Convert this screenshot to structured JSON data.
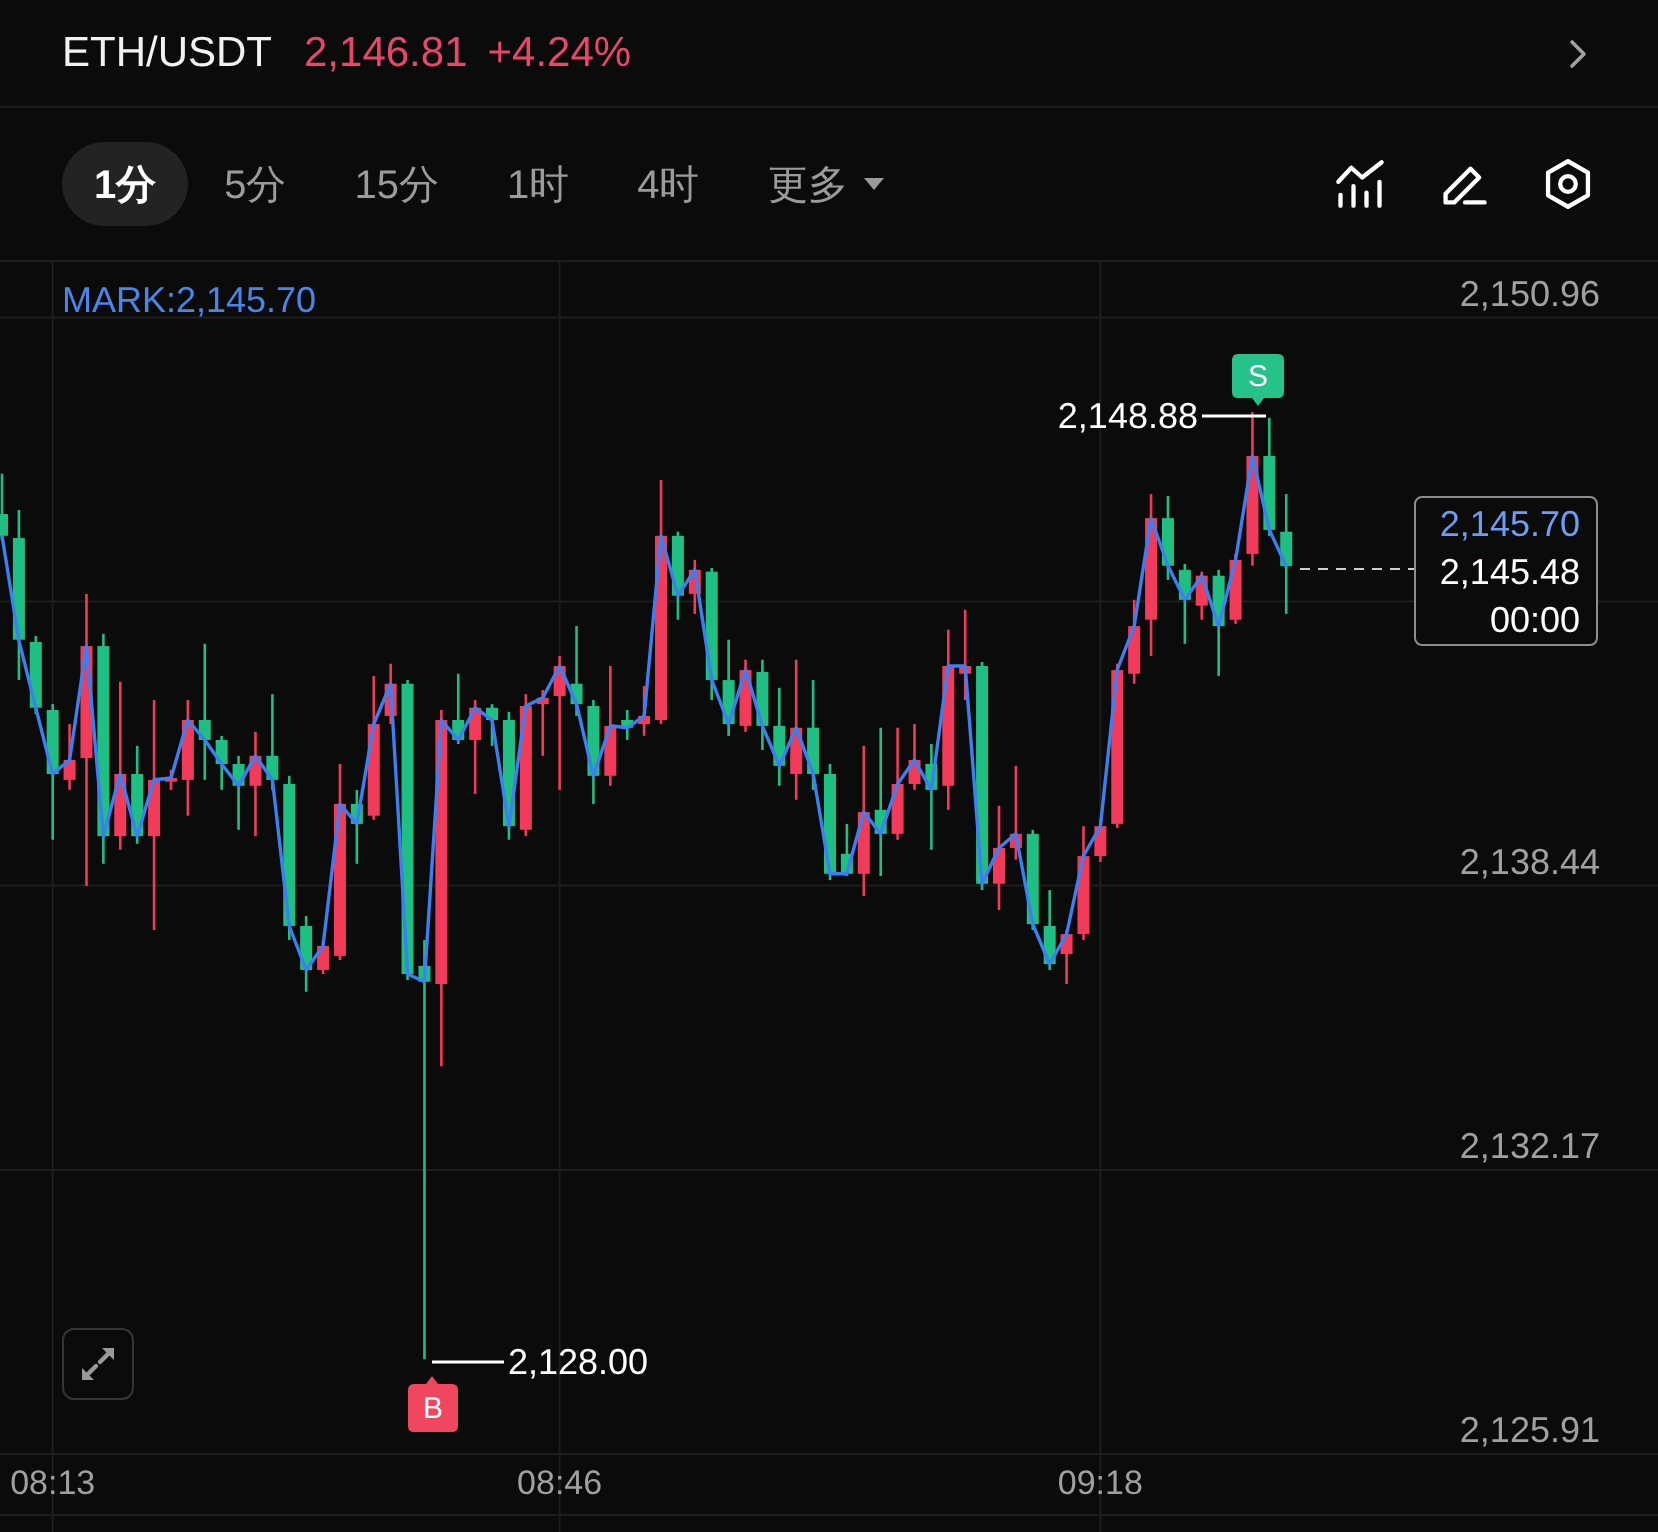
{
  "header": {
    "symbol": "ETH/USDT",
    "price": "2,146.81",
    "change": "+4.24%"
  },
  "intervals": [
    {
      "label": "1分",
      "selected": true,
      "kind": "interval"
    },
    {
      "label": "5分",
      "selected": false,
      "kind": "interval"
    },
    {
      "label": "15分",
      "selected": false,
      "kind": "interval"
    },
    {
      "label": "1时",
      "selected": false,
      "kind": "interval"
    },
    {
      "label": "4时",
      "selected": false,
      "kind": "interval"
    },
    {
      "label": "更多",
      "selected": false,
      "kind": "menu"
    }
  ],
  "chart": {
    "mark_label": "MARK:2,145.70",
    "markers": [
      {
        "kind": "sell",
        "letter": "S",
        "price": "2,148.88"
      },
      {
        "kind": "buy",
        "letter": "B",
        "price": "2,128.00"
      }
    ],
    "price_tag": {
      "mark_price": "2,145.70",
      "last_price": "2,145.48",
      "countdown": "00:00"
    },
    "chart_data": {
      "type": "candlestick",
      "grid": true,
      "ylim": [
        2125.91,
        2152.23
      ],
      "yticks": [
        {
          "value": 2150.96,
          "label": "2,150.96"
        },
        {
          "value": 2138.44,
          "label": "2,138.44"
        },
        {
          "value": 2132.17,
          "label": "2,132.17"
        },
        {
          "value": 2125.91,
          "label": "2,125.91"
        }
      ],
      "categories": [
        null,
        null,
        null,
        "08:13",
        null,
        null,
        null,
        null,
        null,
        null,
        null,
        null,
        null,
        null,
        null,
        null,
        null,
        null,
        null,
        null,
        null,
        null,
        null,
        null,
        null,
        null,
        null,
        null,
        null,
        null,
        null,
        null,
        null,
        "08:46",
        null,
        null,
        null,
        null,
        null,
        null,
        null,
        null,
        null,
        null,
        null,
        null,
        null,
        null,
        null,
        null,
        null,
        null,
        null,
        null,
        null,
        null,
        null,
        null,
        null,
        null,
        null,
        null,
        null,
        null,
        null,
        "09:18",
        null,
        null,
        null,
        null,
        null,
        null,
        null,
        null,
        null,
        null,
        null
      ],
      "ohlc": [
        [
          2146.63,
          2147.52,
          2146.06,
          2146.15
        ],
        [
          2146.1,
          2146.72,
          2142.97,
          2143.86
        ],
        [
          2143.81,
          2143.94,
          2142.22,
          2142.36
        ],
        [
          2142.31,
          2142.44,
          2139.45,
          2140.9
        ],
        [
          2140.77,
          2142.0,
          2140.55,
          2141.21
        ],
        [
          2141.25,
          2144.87,
          2138.43,
          2143.72
        ],
        [
          2143.72,
          2143.99,
          2138.92,
          2139.53
        ],
        [
          2139.53,
          2142.93,
          2139.23,
          2140.9
        ],
        [
          2140.9,
          2141.52,
          2139.36,
          2139.53
        ],
        [
          2139.53,
          2142.53,
          2137.46,
          2140.77
        ],
        [
          2140.73,
          2140.99,
          2140.55,
          2140.81
        ],
        [
          2140.77,
          2142.53,
          2139.98,
          2142.09
        ],
        [
          2142.09,
          2143.77,
          2140.77,
          2141.65
        ],
        [
          2141.65,
          2141.74,
          2140.55,
          2141.12
        ],
        [
          2141.12,
          2141.3,
          2139.67,
          2140.64
        ],
        [
          2140.64,
          2141.83,
          2139.53,
          2141.3
        ],
        [
          2141.3,
          2142.66,
          2140.55,
          2140.77
        ],
        [
          2140.68,
          2140.86,
          2137.24,
          2137.55
        ],
        [
          2137.55,
          2137.77,
          2136.1,
          2136.58
        ],
        [
          2136.58,
          2137.24,
          2136.49,
          2137.11
        ],
        [
          2136.89,
          2141.12,
          2136.8,
          2140.24
        ],
        [
          2140.24,
          2140.55,
          2138.92,
          2139.8
        ],
        [
          2139.98,
          2143.06,
          2139.89,
          2142.0
        ],
        [
          2142.18,
          2143.33,
          2142.0,
          2142.89
        ],
        [
          2142.89,
          2142.97,
          2136.36,
          2136.49
        ],
        [
          2136.67,
          2137.24,
          2128.0,
          2136.32
        ],
        [
          2136.27,
          2142.31,
          2134.46,
          2142.09
        ],
        [
          2142.09,
          2143.11,
          2141.56,
          2141.65
        ],
        [
          2141.65,
          2142.53,
          2140.46,
          2142.36
        ],
        [
          2142.36,
          2142.44,
          2141.52,
          2142.09
        ],
        [
          2142.09,
          2142.27,
          2139.45,
          2139.75
        ],
        [
          2139.67,
          2142.66,
          2139.53,
          2142.4
        ],
        [
          2142.44,
          2142.75,
          2141.3,
          2142.58
        ],
        [
          2142.62,
          2143.5,
          2140.55,
          2143.28
        ],
        [
          2142.89,
          2144.16,
          2142.18,
          2142.44
        ],
        [
          2142.4,
          2142.53,
          2140.24,
          2140.86
        ],
        [
          2140.86,
          2143.28,
          2140.64,
          2141.96
        ],
        [
          2142.09,
          2142.31,
          2141.65,
          2141.92
        ],
        [
          2142.0,
          2142.84,
          2141.74,
          2142.18
        ],
        [
          2142.09,
          2147.38,
          2142.0,
          2146.15
        ],
        [
          2146.15,
          2146.24,
          2144.3,
          2144.83
        ],
        [
          2144.87,
          2145.62,
          2144.43,
          2145.4
        ],
        [
          2145.36,
          2145.44,
          2142.53,
          2142.97
        ],
        [
          2142.97,
          2143.86,
          2141.74,
          2142.0
        ],
        [
          2141.96,
          2143.42,
          2141.83,
          2143.19
        ],
        [
          2143.15,
          2143.42,
          2141.43,
          2141.96
        ],
        [
          2141.96,
          2142.8,
          2140.64,
          2141.08
        ],
        [
          2140.9,
          2143.42,
          2140.33,
          2141.92
        ],
        [
          2141.92,
          2142.97,
          2140.55,
          2140.9
        ],
        [
          2140.9,
          2141.12,
          2138.56,
          2138.7
        ],
        [
          2139.14,
          2139.8,
          2138.65,
          2138.7
        ],
        [
          2138.7,
          2141.52,
          2138.21,
          2140.06
        ],
        [
          2140.11,
          2141.92,
          2138.65,
          2139.58
        ],
        [
          2139.58,
          2141.92,
          2139.45,
          2140.68
        ],
        [
          2140.68,
          2142.0,
          2140.55,
          2141.21
        ],
        [
          2141.12,
          2141.56,
          2139.23,
          2140.55
        ],
        [
          2140.64,
          2144.08,
          2140.11,
          2143.28
        ],
        [
          2143.11,
          2144.52,
          2142.53,
          2143.28
        ],
        [
          2143.28,
          2143.37,
          2138.34,
          2138.48
        ],
        [
          2138.48,
          2140.2,
          2137.9,
          2139.27
        ],
        [
          2139.27,
          2141.08,
          2139.01,
          2139.58
        ],
        [
          2139.58,
          2139.67,
          2137.46,
          2137.59
        ],
        [
          2137.55,
          2138.34,
          2136.58,
          2136.71
        ],
        [
          2136.93,
          2137.46,
          2136.27,
          2137.37
        ],
        [
          2137.37,
          2139.75,
          2137.24,
          2139.09
        ],
        [
          2139.09,
          2139.89,
          2138.96,
          2139.75
        ],
        [
          2139.8,
          2143.33,
          2139.71,
          2143.19
        ],
        [
          2143.11,
          2144.74,
          2142.89,
          2144.16
        ],
        [
          2144.3,
          2147.07,
          2143.5,
          2146.54
        ],
        [
          2146.54,
          2147.03,
          2145.18,
          2145.49
        ],
        [
          2145.4,
          2145.53,
          2143.77,
          2144.74
        ],
        [
          2144.61,
          2145.36,
          2144.3,
          2145.27
        ],
        [
          2145.27,
          2145.4,
          2143.06,
          2144.16
        ],
        [
          2144.3,
          2145.75,
          2144.21,
          2145.62
        ],
        [
          2145.75,
          2148.88,
          2145.49,
          2147.91
        ],
        [
          2147.91,
          2148.75,
          2146.15,
          2146.28
        ],
        [
          2146.24,
          2147.07,
          2144.43,
          2145.48
        ]
      ],
      "series": [
        {
          "type": "line",
          "color": "#3b7ff2",
          "values": [
            2146.15,
            2143.86,
            2142.36,
            2140.9,
            2141.21,
            2143.72,
            2139.53,
            2140.9,
            2139.53,
            2140.77,
            2140.81,
            2142.09,
            2141.65,
            2141.12,
            2140.64,
            2141.3,
            2140.77,
            2137.55,
            2136.58,
            2137.11,
            2140.24,
            2139.8,
            2142.0,
            2142.89,
            2136.49,
            2136.32,
            2142.09,
            2141.65,
            2142.36,
            2142.09,
            2139.75,
            2142.4,
            2142.58,
            2143.28,
            2142.44,
            2140.86,
            2141.96,
            2141.92,
            2142.18,
            2146.15,
            2144.83,
            2145.4,
            2142.97,
            2142.0,
            2143.19,
            2141.96,
            2141.08,
            2141.92,
            2140.9,
            2138.7,
            2138.7,
            2140.06,
            2139.58,
            2140.68,
            2141.21,
            2140.55,
            2143.28,
            2143.28,
            2138.48,
            2139.27,
            2139.58,
            2137.59,
            2136.71,
            2137.37,
            2139.09,
            2139.75,
            2143.19,
            2144.16,
            2146.54,
            2145.49,
            2144.74,
            2145.27,
            2144.16,
            2145.62,
            2147.91,
            2146.28,
            2145.48
          ]
        }
      ]
    }
  }
}
